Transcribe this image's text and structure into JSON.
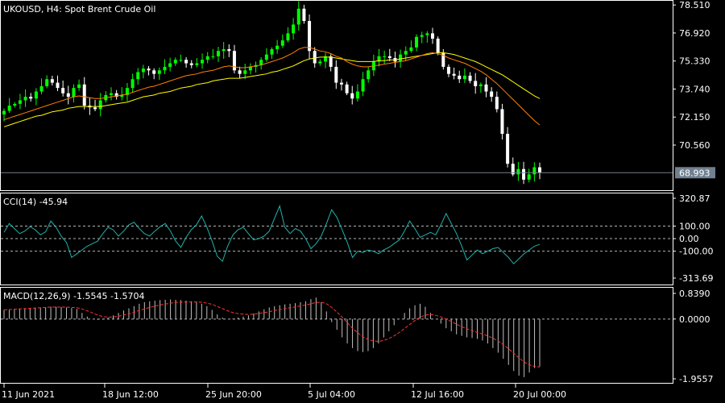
{
  "chart_data": [
    {
      "panel": "price",
      "type": "candlestick",
      "symbol": "UKOUSD",
      "timeframe": "H4",
      "description": "Spot Brent Crude Oil",
      "ylim": [
        68.0,
        78.7
      ],
      "yticks": [
        "78.510",
        "76.920",
        "75.330",
        "73.740",
        "72.150",
        "70.560"
      ],
      "current_price": "68.993",
      "current_price_value": 68.993,
      "grid": false,
      "colors": {
        "bull": "#00ff00",
        "bear": "#ffffff",
        "ma_fast": "#ff8000",
        "ma_slow": "#ffff00",
        "price_line": "#708090"
      },
      "close": [
        72.5,
        72.8,
        72.9,
        73.1,
        73.3,
        73.2,
        73.6,
        73.9,
        74.3,
        74.1,
        73.8,
        73.5,
        73.3,
        73.8,
        74.0,
        72.8,
        72.7,
        72.6,
        73.1,
        73.4,
        73.5,
        73.3,
        73.4,
        73.8,
        74.3,
        74.7,
        74.9,
        74.8,
        74.6,
        74.8,
        75.0,
        75.2,
        75.4,
        75.4,
        75.2,
        75.1,
        75.2,
        75.4,
        75.6,
        75.6,
        75.9,
        76.0,
        75.9,
        74.8,
        74.6,
        74.8,
        75.0,
        75.1,
        75.4,
        75.7,
        76.0,
        76.2,
        76.5,
        76.9,
        77.4,
        78.3,
        77.6,
        75.9,
        75.2,
        75.3,
        75.6,
        75.0,
        74.1,
        74.0,
        73.5,
        73.2,
        73.6,
        74.3,
        74.8,
        75.3,
        75.6,
        75.6,
        75.5,
        75.3,
        75.7,
        75.9,
        76.1,
        76.7,
        76.8,
        76.9,
        76.6,
        75.8,
        75.0,
        74.6,
        74.5,
        74.3,
        74.5,
        74.2,
        73.9,
        74.0,
        73.6,
        73.3,
        72.6,
        71.2,
        69.5,
        68.9,
        69.2,
        68.6,
        68.9,
        69.3,
        68.99
      ],
      "ma_fast": [
        72.0,
        72.1,
        72.2,
        72.3,
        72.4,
        72.5,
        72.6,
        72.7,
        72.8,
        72.9,
        73.0,
        73.1,
        73.2,
        73.3,
        73.35,
        73.3,
        73.25,
        73.2,
        73.2,
        73.25,
        73.3,
        73.35,
        73.4,
        73.45,
        73.55,
        73.65,
        73.75,
        73.85,
        73.9,
        74.0,
        74.1,
        74.2,
        74.3,
        74.4,
        74.5,
        74.55,
        74.6,
        74.7,
        74.75,
        74.8,
        74.9,
        75.0,
        75.05,
        75.0,
        74.95,
        74.95,
        75.0,
        75.05,
        75.1,
        75.2,
        75.3,
        75.4,
        75.5,
        75.65,
        75.8,
        76.0,
        76.1,
        76.1,
        76.0,
        75.9,
        75.85,
        75.75,
        75.6,
        75.5,
        75.3,
        75.15,
        75.05,
        75.0,
        75.0,
        75.05,
        75.1,
        75.15,
        75.2,
        75.25,
        75.3,
        75.35,
        75.45,
        75.55,
        75.65,
        75.75,
        75.8,
        75.75,
        75.65,
        75.5,
        75.4,
        75.3,
        75.2,
        75.05,
        74.9,
        74.75,
        74.55,
        74.3,
        74.05,
        73.75,
        73.45,
        73.15,
        72.85,
        72.55,
        72.25,
        71.95,
        71.7
      ],
      "ma_slow": [
        71.6,
        71.7,
        71.8,
        71.9,
        72.0,
        72.1,
        72.2,
        72.25,
        72.35,
        72.45,
        72.5,
        72.55,
        72.65,
        72.7,
        72.75,
        72.75,
        72.75,
        72.75,
        72.75,
        72.8,
        72.85,
        72.9,
        72.95,
        73.0,
        73.1,
        73.2,
        73.3,
        73.35,
        73.4,
        73.5,
        73.55,
        73.6,
        73.7,
        73.8,
        73.85,
        73.9,
        74.0,
        74.05,
        74.1,
        74.2,
        74.25,
        74.3,
        74.35,
        74.35,
        74.35,
        74.4,
        74.45,
        74.5,
        74.55,
        74.6,
        74.7,
        74.75,
        74.85,
        74.95,
        75.05,
        75.2,
        75.35,
        75.45,
        75.5,
        75.55,
        75.55,
        75.55,
        75.5,
        75.45,
        75.4,
        75.35,
        75.3,
        75.3,
        75.3,
        75.3,
        75.35,
        75.35,
        75.4,
        75.4,
        75.45,
        75.5,
        75.55,
        75.6,
        75.65,
        75.7,
        75.75,
        75.8,
        75.8,
        75.75,
        75.7,
        75.6,
        75.5,
        75.4,
        75.3,
        75.15,
        75.0,
        74.85,
        74.7,
        74.55,
        74.35,
        74.15,
        73.95,
        73.75,
        73.55,
        73.35,
        73.2
      ]
    },
    {
      "panel": "cci",
      "type": "line",
      "indicator": "CCI(14)",
      "current_value": "-45.94",
      "ylim": [
        -313.69,
        320.87
      ],
      "yticks": [
        "320.87",
        "100.00",
        "0.00",
        "-100.00",
        "-313.69"
      ],
      "levels": [
        100,
        0,
        -100
      ],
      "grid": false,
      "colors": {
        "line": "#20b2aa",
        "levels": "#b4b4b4"
      },
      "values": [
        50,
        120,
        80,
        40,
        60,
        95,
        70,
        30,
        55,
        140,
        90,
        20,
        -30,
        -150,
        -120,
        -90,
        -60,
        -40,
        -20,
        40,
        90,
        70,
        20,
        60,
        110,
        130,
        80,
        40,
        20,
        60,
        95,
        120,
        60,
        -20,
        -70,
        10,
        70,
        110,
        180,
        90,
        -20,
        -140,
        -180,
        -60,
        30,
        70,
        90,
        40,
        -10,
        0,
        20,
        60,
        160,
        260,
        90,
        40,
        80,
        60,
        0,
        -80,
        -40,
        20,
        120,
        230,
        170,
        70,
        -30,
        -150,
        -100,
        -110,
        -90,
        -100,
        -120,
        -90,
        -70,
        -40,
        -10,
        60,
        140,
        80,
        10,
        30,
        50,
        30,
        110,
        200,
        120,
        40,
        -60,
        -170,
        -130,
        -90,
        -120,
        -100,
        -80,
        -70,
        -110,
        -150,
        -200,
        -160,
        -120,
        -90,
        -60,
        -45.94
      ]
    },
    {
      "panel": "macd",
      "type": "histogram+line",
      "indicator": "MACD(12,26,9)",
      "current_main": "-1.5545",
      "current_signal": "-1.5704",
      "ylim": [
        -1.9557,
        0.839
      ],
      "yticks": [
        "0.8390",
        "0.0000",
        "-1.9557"
      ],
      "zero_line": true,
      "grid": false,
      "colors": {
        "histogram": "#c0c0c0",
        "signal": "#ff3030",
        "zero": "#b4b4b4"
      },
      "histogram": [
        0.3,
        0.32,
        0.33,
        0.34,
        0.35,
        0.36,
        0.37,
        0.38,
        0.39,
        0.4,
        0.4,
        0.39,
        0.38,
        0.36,
        0.33,
        0.2,
        0.08,
        0.0,
        -0.03,
        -0.02,
        0.05,
        0.12,
        0.2,
        0.28,
        0.35,
        0.42,
        0.5,
        0.55,
        0.58,
        0.6,
        0.62,
        0.63,
        0.64,
        0.63,
        0.62,
        0.6,
        0.58,
        0.55,
        0.5,
        0.42,
        0.3,
        0.15,
        0.05,
        0.0,
        0.02,
        0.05,
        0.08,
        0.12,
        0.18,
        0.25,
        0.32,
        0.38,
        0.42,
        0.45,
        0.48,
        0.5,
        0.52,
        0.55,
        0.58,
        0.65,
        0.7,
        0.55,
        0.25,
        -0.1,
        -0.35,
        -0.6,
        -0.8,
        -0.95,
        -1.05,
        -1.08,
        -1.05,
        -0.95,
        -0.8,
        -0.6,
        -0.4,
        -0.2,
        0.0,
        0.2,
        0.35,
        0.45,
        0.5,
        0.4,
        0.2,
        0.0,
        -0.15,
        -0.3,
        -0.4,
        -0.5,
        -0.55,
        -0.6,
        -0.62,
        -0.65,
        -0.7,
        -0.8,
        -0.95,
        -1.1,
        -1.3,
        -1.5,
        -1.7,
        -1.85,
        -1.9,
        -1.75,
        -1.6,
        -1.5545
      ],
      "signal": [
        0.3,
        0.31,
        0.32,
        0.33,
        0.34,
        0.35,
        0.36,
        0.37,
        0.38,
        0.39,
        0.39,
        0.39,
        0.39,
        0.38,
        0.37,
        0.33,
        0.27,
        0.2,
        0.13,
        0.08,
        0.06,
        0.07,
        0.09,
        0.13,
        0.17,
        0.22,
        0.28,
        0.33,
        0.38,
        0.42,
        0.46,
        0.49,
        0.52,
        0.54,
        0.55,
        0.56,
        0.56,
        0.56,
        0.55,
        0.52,
        0.48,
        0.41,
        0.34,
        0.27,
        0.21,
        0.18,
        0.16,
        0.15,
        0.16,
        0.18,
        0.21,
        0.24,
        0.28,
        0.31,
        0.34,
        0.37,
        0.4,
        0.43,
        0.46,
        0.5,
        0.54,
        0.55,
        0.5,
        0.38,
        0.23,
        0.06,
        -0.12,
        -0.3,
        -0.45,
        -0.58,
        -0.67,
        -0.72,
        -0.73,
        -0.7,
        -0.64,
        -0.55,
        -0.44,
        -0.31,
        -0.18,
        -0.05,
        0.06,
        0.13,
        0.15,
        0.12,
        0.07,
        0.0,
        -0.08,
        -0.17,
        -0.25,
        -0.32,
        -0.38,
        -0.44,
        -0.49,
        -0.55,
        -0.63,
        -0.72,
        -0.84,
        -0.97,
        -1.12,
        -1.27,
        -1.4,
        -1.5,
        -1.55,
        -1.5704
      ]
    }
  ],
  "time_axis": {
    "labels": [
      "11 Jun 2021",
      "18 Jun 12:00",
      "25 Jun 20:00",
      "5 Jul 04:00",
      "12 Jul 16:00",
      "20 Jul 00:00"
    ]
  }
}
